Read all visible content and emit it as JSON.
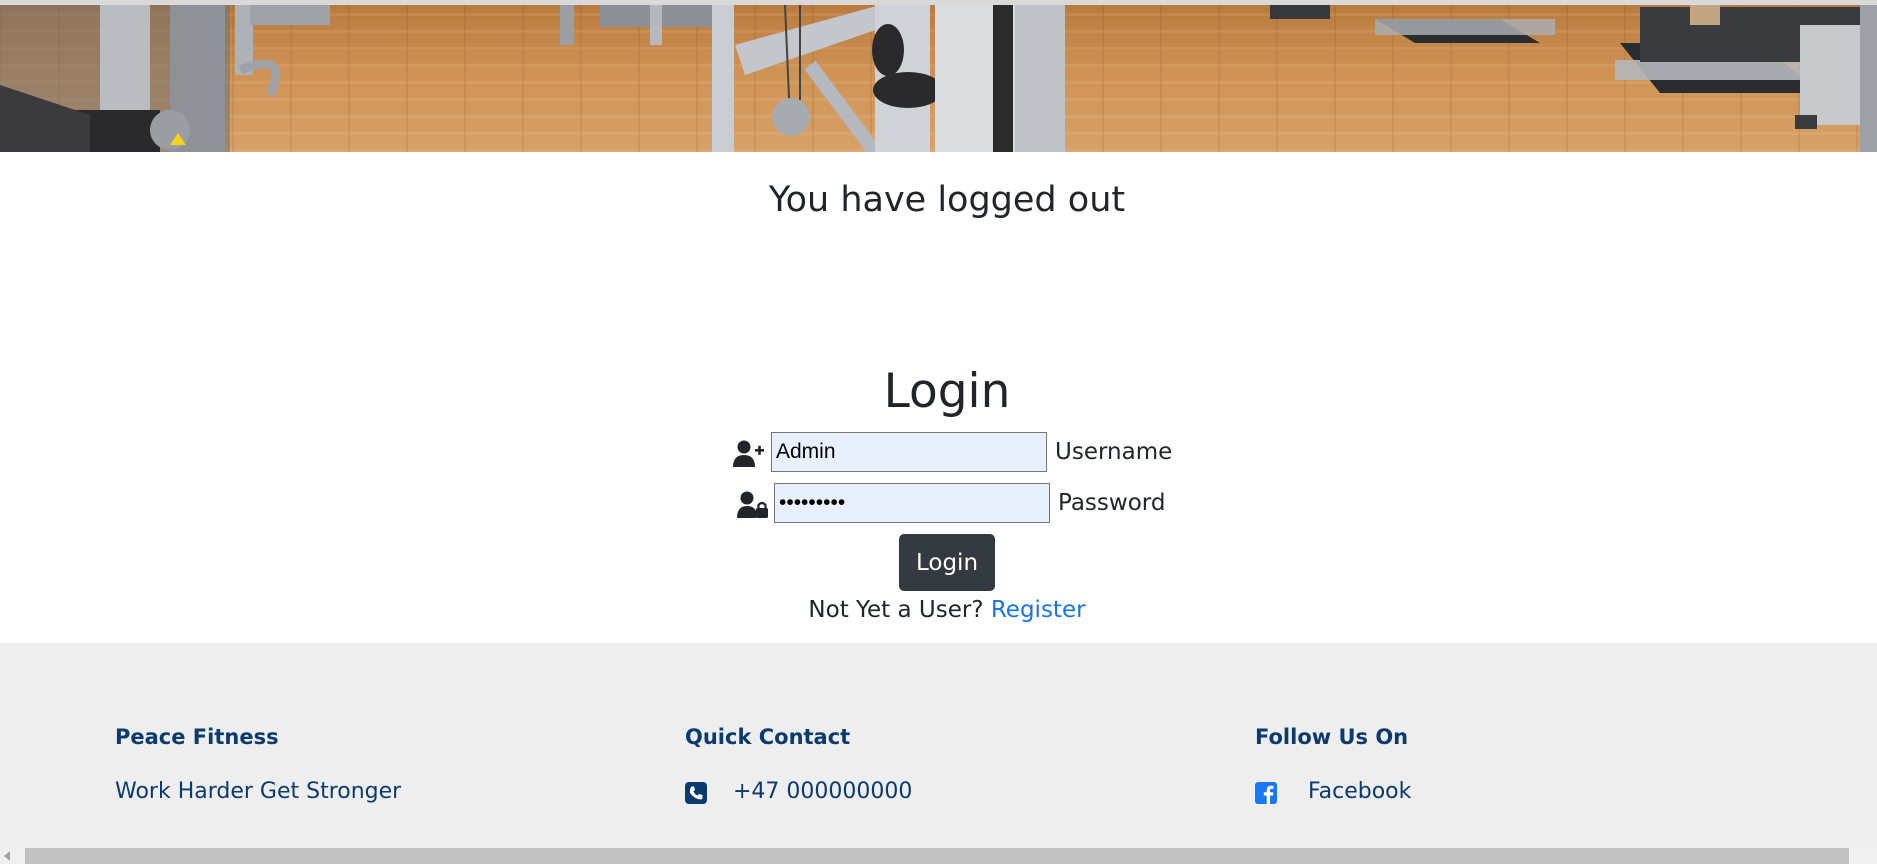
{
  "hero": {
    "image": "gym-interior-banner"
  },
  "messages": {
    "logged_out": "You have logged out"
  },
  "login": {
    "title": "Login",
    "username": {
      "value": "Admin",
      "label": "Username",
      "icon": "user-plus-icon"
    },
    "password": {
      "value": "•••••••••",
      "label": "Password",
      "icon": "user-lock-icon"
    },
    "submit_label": "Login",
    "register_prompt": "Not Yet a User?",
    "register_link": "Register"
  },
  "footer": {
    "col1": {
      "heading": "Peace Fitness",
      "text": "Work Harder Get Stronger"
    },
    "col2": {
      "heading": "Quick Contact",
      "phone": "+47 000000000",
      "icon": "phone-icon"
    },
    "col3": {
      "heading": "Follow Us On",
      "link": "Facebook",
      "icon": "facebook-icon"
    }
  },
  "colors": {
    "footer_text": "#0b3a6e",
    "link": "#1a73e8",
    "button_bg": "#343a40",
    "footer_bg": "#eeeeee",
    "input_bg": "#e8f0fe"
  }
}
